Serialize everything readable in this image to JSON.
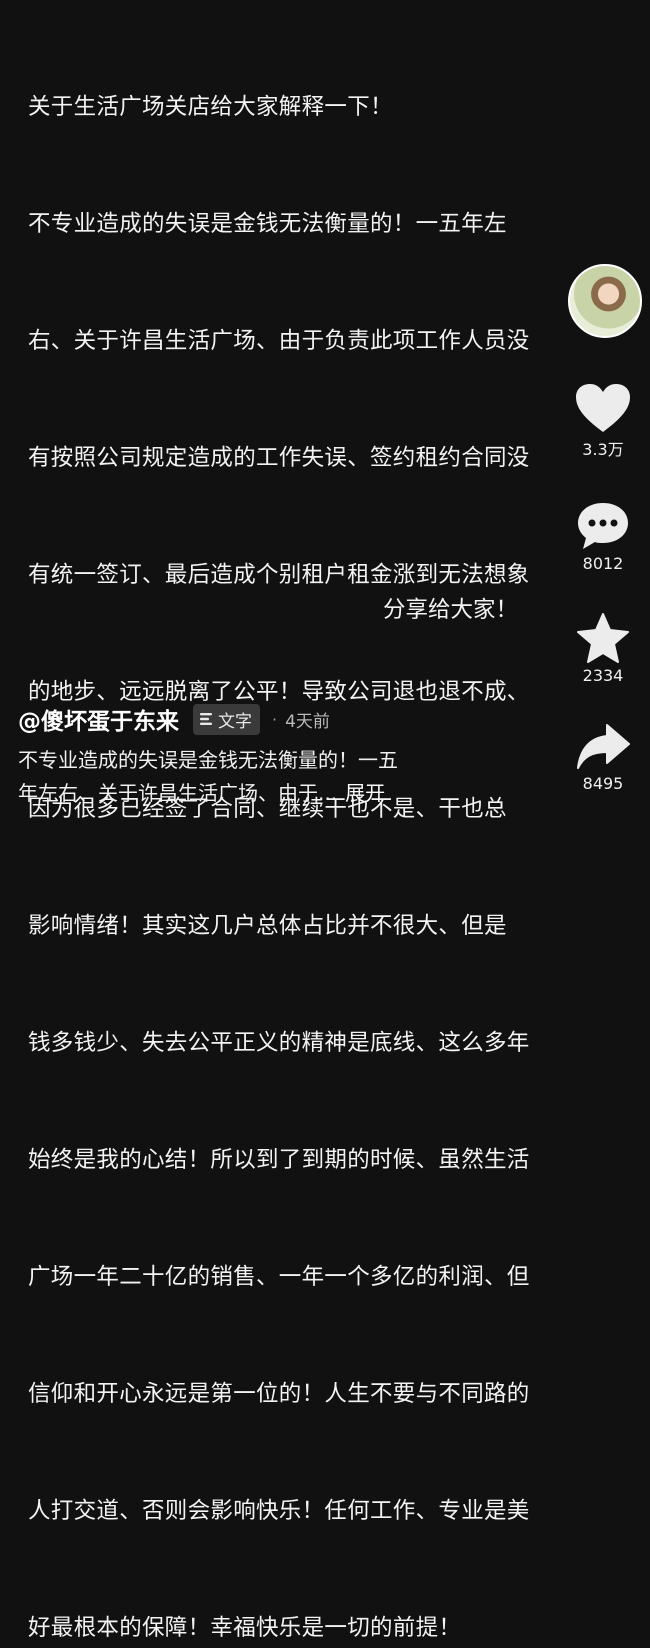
{
  "post": {
    "lines": [
      "关于生活广场关店给大家解释一下！",
      "不专业造成的失误是金钱无法衡量的！一五年左",
      "右、关于许昌生活广场、由于负责此项工作人员没",
      "有按照公司规定造成的工作失误、签约租约合同没",
      "有统一签订、最后造成个别租户租金涨到无法想象",
      "的地步、远远脱离了公平！导致公司退也退不成、",
      "因为很多已经签了合同、继续干也不是、干也总",
      "影响情绪！其实这几户总体占比并不很大、但是",
      "钱多钱少、失去公平正义的精神是底线、这么多年",
      "始终是我的心结！所以到了到期的时候、虽然生活",
      "广场一年二十亿的销售、一年一个多亿的利润、但",
      "信仰和开心永远是第一位的！人生不要与不同路的",
      "人打交道、否则会影响快乐！任何工作、专业是美",
      "好最根本的保障！幸福快乐是一切的前提！"
    ],
    "closing": "分享给大家！"
  },
  "rail": {
    "likes": "3.3万",
    "comments": "8012",
    "favorites": "2334",
    "shares": "8495"
  },
  "meta": {
    "author": "@傻坏蛋于东来",
    "tag": "文字",
    "dot": "·",
    "time": "4天前",
    "desc_line1": "不专业造成的失误是金钱无法衡量的！一五",
    "desc_line2": "年左右、关于许昌生活广场、由于...",
    "expand": "展开"
  },
  "colors": {
    "background": "#111111",
    "text": "#f3f3f3",
    "icon": "#ffffff"
  },
  "icons": [
    "heart-icon",
    "comment-icon",
    "star-icon",
    "share-icon",
    "text-lines-icon"
  ]
}
